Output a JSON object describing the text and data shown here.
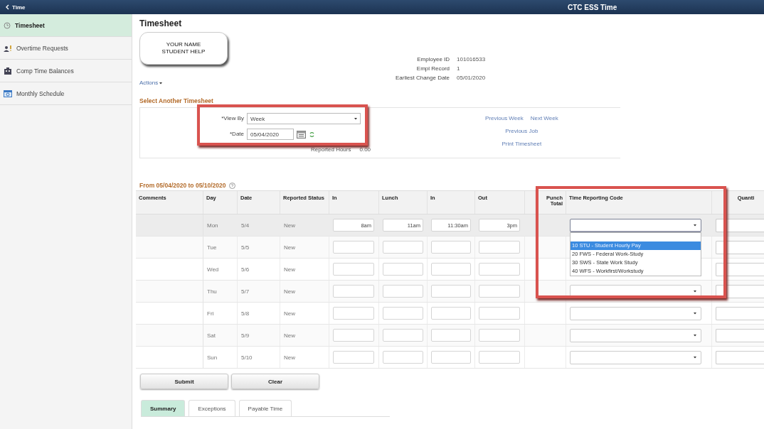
{
  "header": {
    "back_label": "Time",
    "title": "CTC ESS Time"
  },
  "sidebar": {
    "items": [
      {
        "label": "Timesheet",
        "selected": true
      },
      {
        "label": "Overtime Requests",
        "selected": false
      },
      {
        "label": "Comp Time Balances",
        "selected": false
      },
      {
        "label": "Monthly Schedule",
        "selected": false
      }
    ]
  },
  "page_title": "Timesheet",
  "name_callout": {
    "lines": [
      "YOUR NAME",
      "STUDENT HELP"
    ]
  },
  "actions_menu": "Actions",
  "employee_info": [
    {
      "label": "Employee ID",
      "value": "101016533"
    },
    {
      "label": "Empl Record",
      "value": "1"
    },
    {
      "label": "Earliest Change Date",
      "value": "05/01/2020"
    }
  ],
  "select_timesheet": {
    "title": "Select Another Timesheet",
    "view_by": {
      "label": "*View By",
      "value": "Week"
    },
    "date": {
      "label": "*Date",
      "value": "05/04/2020"
    },
    "reported_hours": {
      "label": "Reported Hours",
      "value": "0.00"
    },
    "link_rows": [
      [
        "Previous Week",
        "Next Week"
      ],
      [
        "Previous Job"
      ],
      [
        "Print Timesheet"
      ]
    ]
  },
  "period": "From 05/04/2020 to 05/10/2020",
  "table": {
    "columns": [
      "Comments",
      "Day",
      "Date",
      "Reported Status",
      "In",
      "Lunch",
      "In",
      "Out",
      "Punch Total",
      "Time Reporting Code",
      "Quanti"
    ],
    "trc_options": [
      {
        "label": "10 STU - Student Hourly Pay",
        "selected": true
      },
      {
        "label": "20 FWS - Federal Work-Study",
        "selected": false
      },
      {
        "label": "30 SWS - State Work Study",
        "selected": false
      },
      {
        "label": "40 WFS - Workfirst/Workstudy",
        "selected": false
      }
    ],
    "rows": [
      {
        "day": "Mon",
        "date": "5/4",
        "status": "New",
        "punches": [
          "8am",
          "11am",
          "11:30am",
          "3pm"
        ],
        "selected": true,
        "trc_expanded": true
      },
      {
        "day": "Tue",
        "date": "5/5",
        "status": "New",
        "selected": false,
        "trc_expanded": false
      },
      {
        "day": "Wed",
        "date": "5/6",
        "status": "New",
        "selected": false,
        "trc_expanded": false
      },
      {
        "day": "Thu",
        "date": "5/7",
        "status": "New",
        "selected": false,
        "trc_expanded": false
      },
      {
        "day": "Fri",
        "date": "5/8",
        "status": "New",
        "selected": false,
        "trc_expanded": false
      },
      {
        "day": "Sat",
        "date": "5/9",
        "status": "New",
        "selected": false,
        "trc_expanded": false
      },
      {
        "day": "Sun",
        "date": "5/10",
        "status": "New",
        "selected": false,
        "trc_expanded": false
      }
    ]
  },
  "buttons": [
    "Submit",
    "Clear"
  ],
  "tabs": [
    {
      "label": "Summary",
      "selected": true
    },
    {
      "label": "Exceptions",
      "selected": false
    },
    {
      "label": "Payable Time",
      "selected": false
    }
  ]
}
